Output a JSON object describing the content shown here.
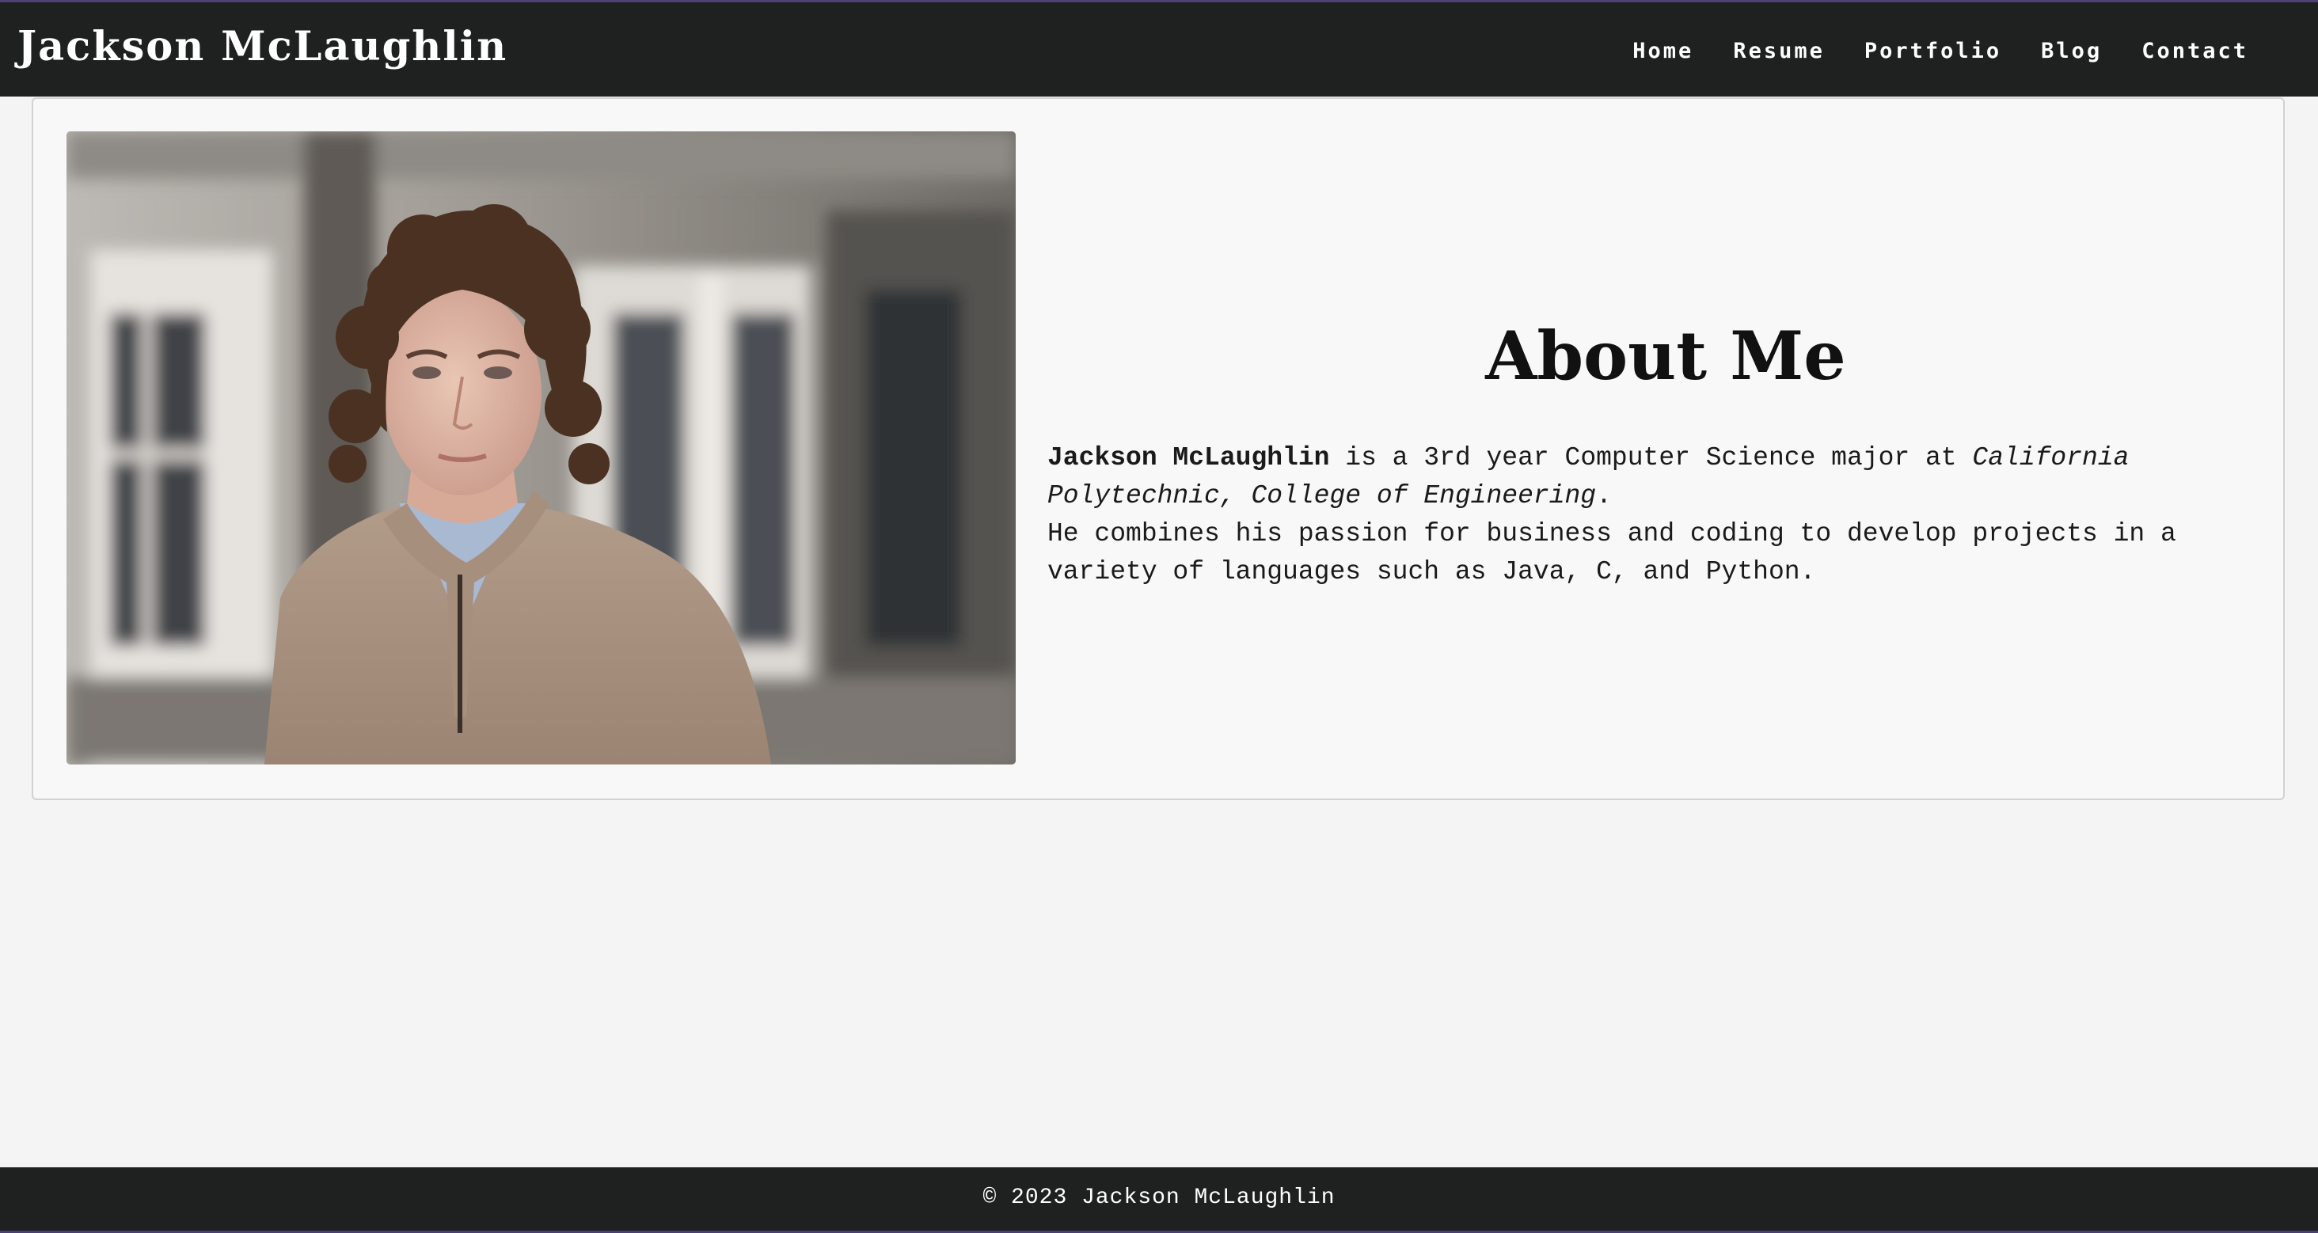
{
  "header": {
    "site_title": "Jackson McLaughlin",
    "nav": [
      {
        "label": "Home"
      },
      {
        "label": "Resume"
      },
      {
        "label": "Portfolio"
      },
      {
        "label": "Blog"
      },
      {
        "label": "Contact"
      }
    ]
  },
  "about": {
    "heading": "About Me",
    "name": "Jackson McLaughlin",
    "intro_middle": " is a 3rd year Computer Science major at ",
    "school": "California Polytechnic, College of Engineering",
    "intro_end": ".",
    "second_line": "He combines his passion for business and coding to develop projects in a variety of languages such as Java, C, and Python."
  },
  "photo": {
    "icon": "portrait-photo"
  },
  "footer": {
    "text": "© 2023 Jackson McLaughlin"
  },
  "colors": {
    "bar": "#1f2121",
    "page_bg": "#f4f4f4",
    "card_bg": "#f8f8f8",
    "accent_edge": "#4b3f73"
  }
}
